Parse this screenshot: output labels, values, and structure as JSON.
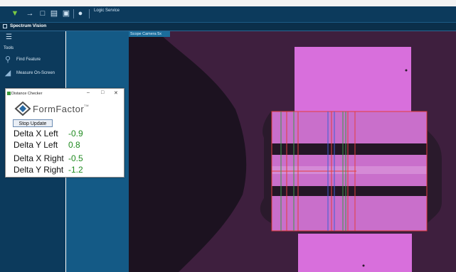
{
  "toolbar": {
    "buttons": [
      "filter-icon",
      "arrow-right-icon",
      "new-file-icon",
      "open-file-icon",
      "save-icon",
      "lightbulb-icon"
    ],
    "logic_label": "Logic Service"
  },
  "app": {
    "title": "Spectrum Vision"
  },
  "sidebar": {
    "tools_label": "Tools",
    "items": [
      {
        "label": "Find Feature",
        "icon": "find-feature-icon"
      },
      {
        "label": "Measure On-Screen",
        "icon": "measure-icon"
      }
    ]
  },
  "camera": {
    "tag": "Scope Camera 5x"
  },
  "dialog": {
    "title": "Distance Checker",
    "logo_text": "FormFactor",
    "logo_tm": "TM",
    "stop_button": "Stop Update",
    "rows": [
      {
        "label": "Delta X Left",
        "value": "-0.9"
      },
      {
        "label": "Delta Y Left",
        "value": "0.8"
      },
      {
        "label": "Delta X Right",
        "value": "-0.5"
      },
      {
        "label": "Delta Y Right",
        "value": "-1.2"
      }
    ],
    "value_color": "#1f8a1f"
  }
}
